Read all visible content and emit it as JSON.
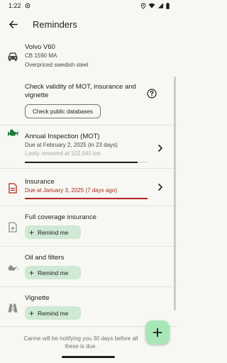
{
  "status_bar": {
    "time": "1:22",
    "icons": [
      "sync-icon",
      "location-icon",
      "wifi-icon",
      "signal-icon",
      "battery-icon"
    ]
  },
  "app_bar": {
    "title": "Reminders",
    "back_icon": "arrow-back-icon"
  },
  "vehicle": {
    "icon": "car-icon",
    "name": "Volvo V60",
    "plate": "CB 1590 MA",
    "description": "Overpriced swedish steel"
  },
  "check_validity": {
    "text": "Check validity of MOT, insurance and vignette",
    "text_line1": "Check validity of MOT, insurance and",
    "text_line2": "vignette",
    "button_label": "Check public databases",
    "help_icon": "help-circle-icon"
  },
  "reminders": [
    {
      "icon": "engine-icon",
      "title": "Annual Inspection (MOT)",
      "due": "Due at February 2, 2025 (in 23 days)",
      "renewed": "Lastly renewed at 102,940 km",
      "progress": 0.92,
      "status": "ok"
    },
    {
      "icon": "document-icon",
      "title": "Insurance",
      "due": "Due at January 3, 2025 (7 days ago)",
      "progress": 1.0,
      "status": "overdue"
    }
  ],
  "inactive": [
    {
      "icon": "add-document-icon",
      "title": "Full coverage insurance",
      "button_label": "Remind me"
    },
    {
      "icon": "oil-can-icon",
      "title": "Oil and filters",
      "button_label": "Remind me"
    },
    {
      "icon": "road-icon",
      "title": "Vignette",
      "button_label": "Remind me"
    }
  ],
  "footer_note": "Carme will be notifying you 30 days before all these is due.",
  "footer_line1": "Carme will be notifying you 30 days before all",
  "footer_line2": "these is due.",
  "fab_icon": "add-icon",
  "colors": {
    "background": "#f7f8f3",
    "accent": "#1f7a3c",
    "overdue": "#b3261e",
    "remind_button": "#cfe9d4",
    "fab": "#a8e6b7"
  }
}
